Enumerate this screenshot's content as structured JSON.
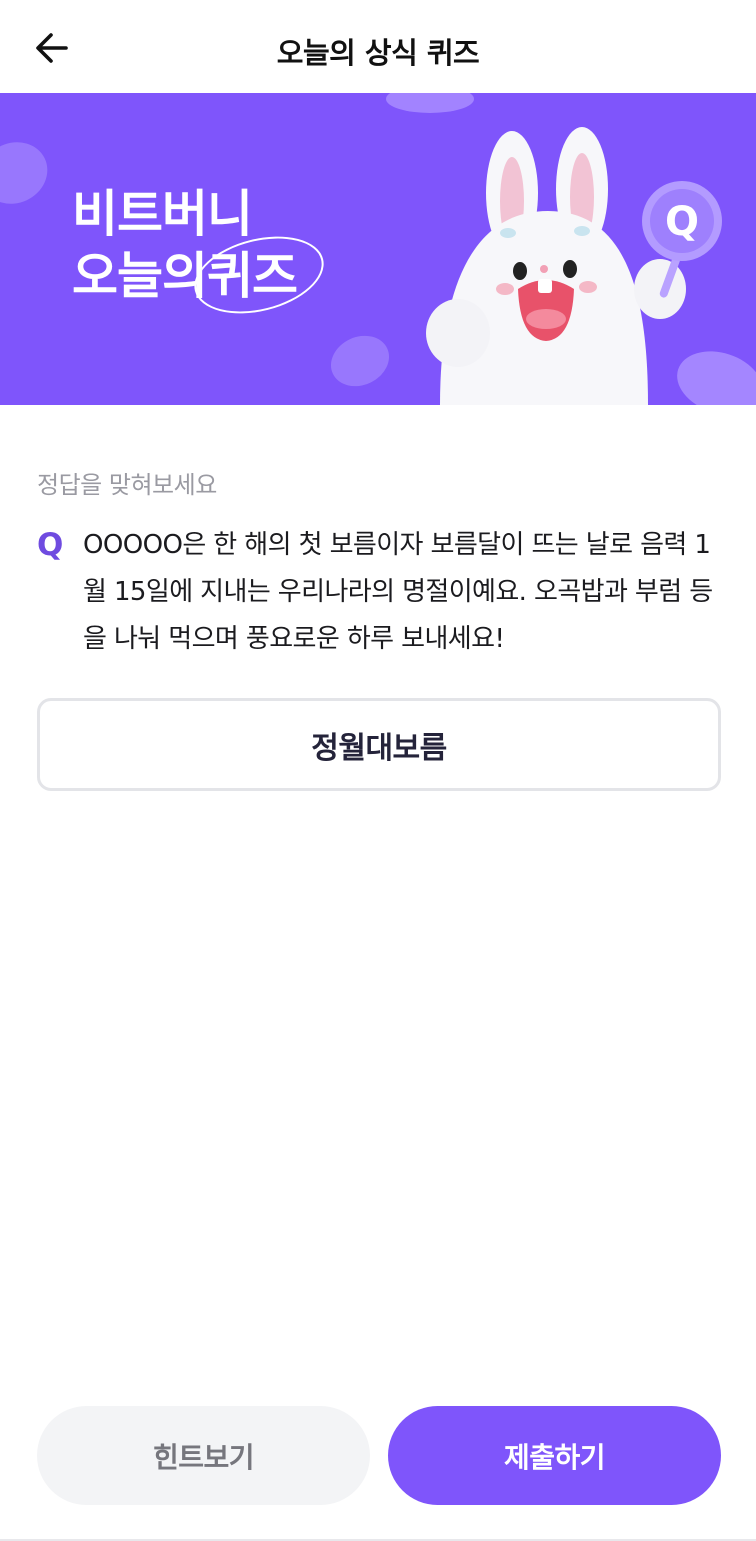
{
  "header": {
    "title": "오늘의 상식 퀴즈",
    "back_icon": "arrow-left-icon"
  },
  "banner": {
    "line1": "비트버니",
    "line2_prefix": "오늘의",
    "line2_circled": "퀴즈",
    "background_color": "#7f55fb",
    "mascot": "white-bunny-illustration",
    "badge_letter": "Q"
  },
  "quiz": {
    "prompt": "정답을 맞혀보세요",
    "q_mark": "Q",
    "question": "OOOOO은 한 해의 첫 보름이자 보름달이 뜨는 날로 음력 1월 15일에 지내는 우리나라의 명절이예요. 오곡밥과 부럼 등을 나눠 먹으며 풍요로운 하루 보내세요!",
    "answer_value": "정월대보름"
  },
  "buttons": {
    "hint_label": "힌트보기",
    "submit_label": "제출하기"
  },
  "colors": {
    "accent": "#7f55fb",
    "q_mark": "#6f4be0",
    "hint_bg": "#f3f4f6"
  }
}
